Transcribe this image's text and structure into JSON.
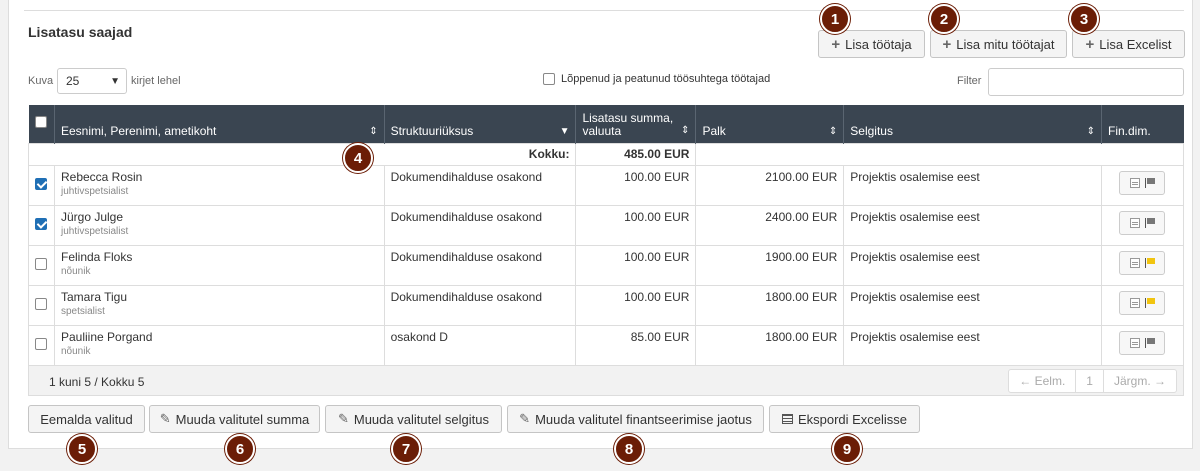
{
  "section_title": "Lisatasu saajad",
  "header_buttons": {
    "add_employee": "Lisa töötaja",
    "add_many": "Lisa mitu töötajat",
    "add_excel": "Lisa Excelist"
  },
  "controls": {
    "show_label": "Kuva",
    "page_size": "25",
    "per_page_label": "kirjet lehel",
    "ended_label": "Lõppenud ja peatunud töösuhtega töötajad",
    "ended_checked": false,
    "filter_label": "Filter",
    "filter_value": ""
  },
  "table": {
    "headers": {
      "name": "Eesnimi, Perenimi, ametikoht",
      "unit": "Struktuuriüksus",
      "amount": "Lisatasu summa, valuuta",
      "salary": "Palk",
      "reason": "Selgitus",
      "findim": "Fin.dim."
    },
    "total_label": "Kokku:",
    "total_value": "485.00 EUR",
    "rows": [
      {
        "name": "Rebecca Rosin",
        "role": "juhtivspetsialist",
        "unit": "Dokumendihalduse osakond",
        "amount": "100.00 EUR",
        "salary": "2100.00 EUR",
        "reason": "Projektis osalemise eest",
        "checked": true,
        "flag": "gray"
      },
      {
        "name": "Jürgo Julge",
        "role": "juhtivspetsialist",
        "unit": "Dokumendihalduse osakond",
        "amount": "100.00 EUR",
        "salary": "2400.00 EUR",
        "reason": "Projektis osalemise eest",
        "checked": true,
        "flag": "gray"
      },
      {
        "name": "Felinda Floks",
        "role": "nõunik",
        "unit": "Dokumendihalduse osakond",
        "amount": "100.00 EUR",
        "salary": "1900.00 EUR",
        "reason": "Projektis osalemise eest",
        "checked": false,
        "flag": "yellow"
      },
      {
        "name": "Tamara Tigu",
        "role": "spetsialist",
        "unit": "Dokumendihalduse osakond",
        "amount": "100.00 EUR",
        "salary": "1800.00 EUR",
        "reason": "Projektis osalemise eest",
        "checked": false,
        "flag": "yellow"
      },
      {
        "name": "Pauliine Porgand",
        "role": "nõunik",
        "unit": "osakond D",
        "amount": "85.00 EUR",
        "salary": "1800.00 EUR",
        "reason": "Projektis osalemise eest",
        "checked": false,
        "flag": "gray"
      }
    ]
  },
  "footer": {
    "info": "1 kuni 5 / Kokku 5",
    "prev": "← Eelm.",
    "page": "1",
    "next": "Järgm. →"
  },
  "bottom_buttons": {
    "remove": "Eemalda valitud",
    "change_sum": "Muuda valitutel summa",
    "change_reason": "Muuda valitutel selgitus",
    "change_financing": "Muuda valitutel finantseerimise jaotus",
    "export": "Ekspordi Excelisse"
  },
  "badges": [
    "1",
    "2",
    "3",
    "4",
    "5",
    "6",
    "7",
    "8",
    "9"
  ],
  "colors": {
    "header_bg": "#3a4551",
    "badge_bg": "#6b1d06",
    "checkbox_blue": "#1f6fb5",
    "flag_yellow": "#f1c40f"
  }
}
